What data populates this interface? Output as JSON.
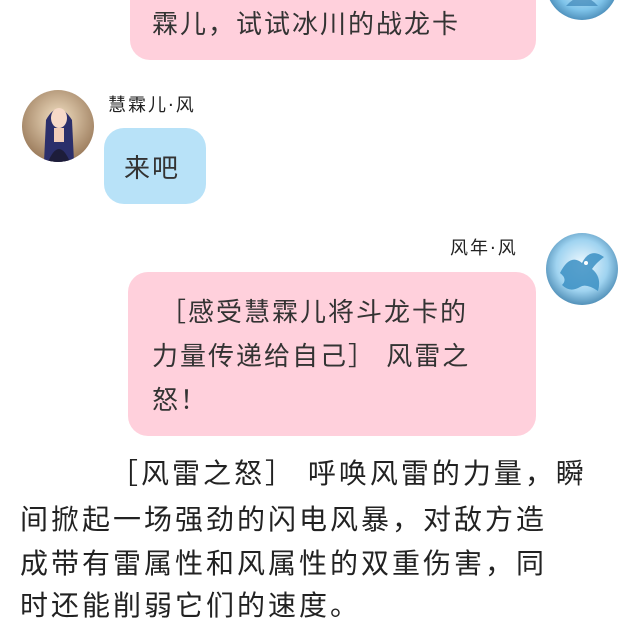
{
  "messages": {
    "top": {
      "text": "霖儿，试试冰川的战龙卡"
    },
    "left": {
      "sender": "慧霖儿·风",
      "text": "来吧"
    },
    "right": {
      "sender": "风年·风",
      "lines": [
        "［感受慧霖儿将斗龙卡的",
        "力量传递给自己］ 风雷之",
        "怒！"
      ]
    }
  },
  "narration": {
    "lines": [
      "［风雷之怒］ 呼唤风雷的力量，瞬",
      "间掀起一场强劲的闪电风暴，对敌方造",
      "成带有雷属性和风属性的双重伤害，同",
      "时还能削弱它们的速度。"
    ]
  },
  "colors": {
    "pink_bubble": "#ffd0dc",
    "blue_bubble": "#b8e2f8",
    "background": "#ffffff"
  },
  "icons": {
    "avatar_top_right": "ice-dragon-avatar",
    "avatar_left": "anime-girl-avatar",
    "avatar_right": "ice-dragon-avatar"
  }
}
